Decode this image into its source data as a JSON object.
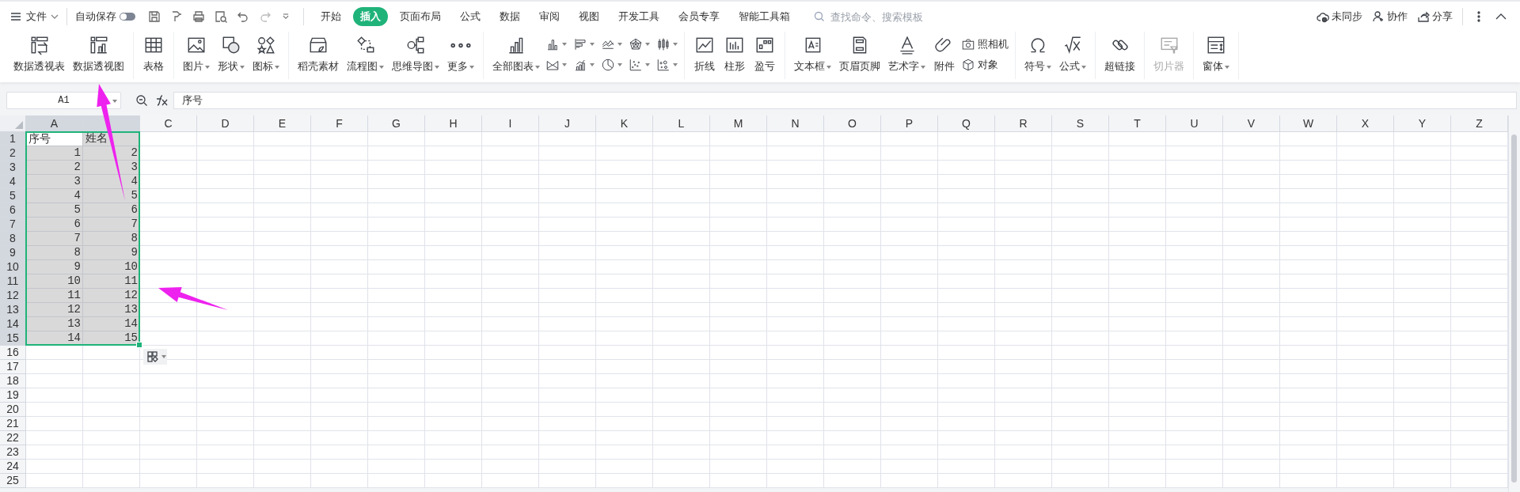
{
  "menu": {
    "label": "文件"
  },
  "autosave": {
    "label": "自动保存",
    "on": false
  },
  "tabs": [
    {
      "label": "开始",
      "selected": false
    },
    {
      "label": "插入",
      "selected": true
    },
    {
      "label": "页面布局",
      "selected": false
    },
    {
      "label": "公式",
      "selected": false
    },
    {
      "label": "数据",
      "selected": false
    },
    {
      "label": "审阅",
      "selected": false
    },
    {
      "label": "视图",
      "selected": false
    },
    {
      "label": "开发工具",
      "selected": false
    },
    {
      "label": "会员专享",
      "selected": false
    },
    {
      "label": "智能工具箱",
      "selected": false
    }
  ],
  "search": {
    "placeholder": "查找命令、搜索模板"
  },
  "actions": [
    {
      "label": "未同步"
    },
    {
      "label": "协作"
    },
    {
      "label": "分享"
    }
  ],
  "ribbon": [
    {
      "items": [
        {
          "kind": "large",
          "label": "数据透视表",
          "dropdown": false,
          "disabled": false
        },
        {
          "kind": "large",
          "label": "数据透视图",
          "dropdown": false,
          "disabled": false
        }
      ]
    },
    {
      "items": [
        {
          "kind": "large",
          "label": "表格",
          "dropdown": false,
          "disabled": false
        }
      ]
    },
    {
      "items": [
        {
          "kind": "large",
          "label": "图片",
          "dropdown": true,
          "disabled": false
        },
        {
          "kind": "large",
          "label": "形状",
          "dropdown": true,
          "disabled": false
        },
        {
          "kind": "large",
          "label": "图标",
          "dropdown": true,
          "disabled": false
        }
      ]
    },
    {
      "items": [
        {
          "kind": "large",
          "label": "稻壳素材",
          "dropdown": false,
          "disabled": false
        },
        {
          "kind": "large",
          "label": "流程图",
          "dropdown": true,
          "disabled": false
        },
        {
          "kind": "large",
          "label": "思维导图",
          "dropdown": true,
          "disabled": false
        },
        {
          "kind": "large",
          "label": "更多",
          "dropdown": true,
          "disabled": false
        }
      ]
    },
    {
      "items": [
        {
          "kind": "large",
          "label": "全部图表",
          "dropdown": true,
          "disabled": false
        },
        {
          "kind": "mini",
          "dropdown": true,
          "disabled": false
        },
        {
          "kind": "mini",
          "dropdown": true,
          "disabled": false
        },
        {
          "kind": "mini",
          "dropdown": true,
          "disabled": false
        },
        {
          "kind": "mini",
          "dropdown": true,
          "disabled": false
        },
        {
          "kind": "mini",
          "dropdown": true,
          "disabled": false
        },
        {
          "kind": "mini",
          "dropdown": true,
          "disabled": false
        },
        {
          "kind": "mini",
          "dropdown": true,
          "disabled": false
        },
        {
          "kind": "mini",
          "dropdown": true,
          "disabled": false
        },
        {
          "kind": "mini",
          "dropdown": true,
          "disabled": false
        },
        {
          "kind": "mini",
          "dropdown": true,
          "disabled": false
        }
      ]
    },
    {
      "items": [
        {
          "kind": "large",
          "label": "折线",
          "dropdown": false,
          "disabled": false
        },
        {
          "kind": "large",
          "label": "柱形",
          "dropdown": false,
          "disabled": false
        },
        {
          "kind": "large",
          "label": "盈亏",
          "dropdown": false,
          "disabled": false
        }
      ]
    },
    {
      "items": [
        {
          "kind": "large",
          "label": "文本框",
          "dropdown": true,
          "disabled": false
        },
        {
          "kind": "large",
          "label": "页眉页脚",
          "dropdown": false,
          "disabled": false
        },
        {
          "kind": "large",
          "label": "艺术字",
          "dropdown": true,
          "disabled": false
        },
        {
          "kind": "large",
          "label": "附件",
          "dropdown": false,
          "disabled": false
        },
        {
          "kind": "small",
          "label": "照相机",
          "dropdown": false,
          "disabled": false
        },
        {
          "kind": "small",
          "label": "对象",
          "dropdown": false,
          "disabled": false
        }
      ]
    },
    {
      "items": [
        {
          "kind": "large",
          "label": "符号",
          "dropdown": true,
          "disabled": false
        },
        {
          "kind": "large",
          "label": "公式",
          "dropdown": true,
          "disabled": false
        }
      ]
    },
    {
      "items": [
        {
          "kind": "large",
          "label": "超链接",
          "dropdown": false,
          "disabled": false
        }
      ]
    },
    {
      "items": [
        {
          "kind": "large",
          "label": "切片器",
          "dropdown": false,
          "disabled": true
        }
      ]
    },
    {
      "items": [
        {
          "kind": "large",
          "label": "窗体",
          "dropdown": true,
          "disabled": false
        }
      ]
    }
  ],
  "name_box": {
    "value": "A1"
  },
  "formula_bar": {
    "value": "序号"
  },
  "sheet": {
    "columns": [
      {
        "label": "A",
        "selected": true
      },
      {
        "selected": true
      },
      {
        "label": "C",
        "selected": false
      },
      {
        "label": "D",
        "selected": false
      },
      {
        "label": "E",
        "selected": false
      },
      {
        "label": "F",
        "selected": false
      },
      {
        "label": "G",
        "selected": false
      },
      {
        "label": "H",
        "selected": false
      },
      {
        "label": "I",
        "selected": false
      },
      {
        "label": "J",
        "selected": false
      },
      {
        "label": "K",
        "selected": false
      },
      {
        "label": "L",
        "selected": false
      },
      {
        "label": "M",
        "selected": false
      },
      {
        "label": "N",
        "selected": false
      },
      {
        "label": "O",
        "selected": false
      },
      {
        "label": "P",
        "selected": false
      },
      {
        "label": "Q",
        "selected": false
      },
      {
        "label": "R",
        "selected": false
      },
      {
        "label": "S",
        "selected": false
      },
      {
        "label": "T",
        "selected": false
      },
      {
        "label": "U",
        "selected": false
      },
      {
        "label": "V",
        "selected": false
      },
      {
        "label": "W",
        "selected": false
      },
      {
        "label": "X",
        "selected": false
      },
      {
        "label": "Y",
        "selected": false
      },
      {
        "label": "Z",
        "selected": false
      }
    ],
    "rows": [
      {
        "label": "1",
        "selected": true,
        "cells": [
          {
            "text": "序号",
            "kind": "text",
            "active": true
          },
          {
            "text": "姓名",
            "kind": "text",
            "active": false
          }
        ]
      },
      {
        "label": "2",
        "selected": true,
        "cells": [
          {
            "text": "1",
            "kind": "number",
            "active": false
          },
          {
            "text": "2",
            "kind": "number",
            "active": false
          }
        ]
      },
      {
        "label": "3",
        "selected": true,
        "cells": [
          {
            "text": "2",
            "kind": "number",
            "active": false
          },
          {
            "text": "3",
            "kind": "number",
            "active": false
          }
        ]
      },
      {
        "label": "4",
        "selected": true,
        "cells": [
          {
            "text": "3",
            "kind": "number",
            "active": false
          },
          {
            "text": "4",
            "kind": "number",
            "active": false
          }
        ]
      },
      {
        "label": "5",
        "selected": true,
        "cells": [
          {
            "text": "4",
            "kind": "number",
            "active": false
          },
          {
            "text": "5",
            "kind": "number",
            "active": false
          }
        ]
      },
      {
        "label": "6",
        "selected": true,
        "cells": [
          {
            "text": "5",
            "kind": "number",
            "active": false
          },
          {
            "text": "6",
            "kind": "number",
            "active": false
          }
        ]
      },
      {
        "label": "7",
        "selected": true,
        "cells": [
          {
            "text": "6",
            "kind": "number",
            "active": false
          },
          {
            "text": "7",
            "kind": "number",
            "active": false
          }
        ]
      },
      {
        "label": "8",
        "selected": true,
        "cells": [
          {
            "text": "7",
            "kind": "number",
            "active": false
          },
          {
            "text": "8",
            "kind": "number",
            "active": false
          }
        ]
      },
      {
        "label": "9",
        "selected": true,
        "cells": [
          {
            "text": "8",
            "kind": "number",
            "active": false
          },
          {
            "text": "9",
            "kind": "number",
            "active": false
          }
        ]
      },
      {
        "label": "10",
        "selected": true,
        "cells": [
          {
            "text": "9",
            "kind": "number",
            "active": false
          },
          {
            "text": "10",
            "kind": "number",
            "active": false
          }
        ]
      },
      {
        "label": "11",
        "selected": true,
        "cells": [
          {
            "text": "10",
            "kind": "number",
            "active": false
          },
          {
            "text": "11",
            "kind": "number",
            "active": false
          }
        ]
      },
      {
        "label": "12",
        "selected": true,
        "cells": [
          {
            "text": "11",
            "kind": "number",
            "active": false
          },
          {
            "text": "12",
            "kind": "number",
            "active": false
          }
        ]
      },
      {
        "label": "13",
        "selected": true,
        "cells": [
          {
            "text": "12",
            "kind": "number",
            "active": false
          },
          {
            "text": "13",
            "kind": "number",
            "active": false
          }
        ]
      },
      {
        "label": "14",
        "selected": true,
        "cells": [
          {
            "text": "13",
            "kind": "number",
            "active": false
          },
          {
            "text": "14",
            "kind": "number",
            "active": false
          }
        ]
      },
      {
        "label": "15",
        "selected": true,
        "cells": [
          {
            "text": "14",
            "kind": "number",
            "active": false
          },
          {
            "text": "15",
            "kind": "number",
            "active": false
          }
        ]
      },
      {
        "label": "16",
        "selected": false,
        "cells": []
      },
      {
        "label": "17",
        "selected": false,
        "cells": []
      },
      {
        "label": "18",
        "selected": false,
        "cells": []
      },
      {
        "label": "19",
        "selected": false,
        "cells": []
      },
      {
        "label": "20",
        "selected": false,
        "cells": []
      },
      {
        "label": "21",
        "selected": false,
        "cells": []
      },
      {
        "label": "22",
        "selected": false,
        "cells": []
      },
      {
        "label": "23",
        "selected": false,
        "cells": []
      },
      {
        "label": "24",
        "selected": false,
        "cells": []
      },
      {
        "label": "25",
        "selected": false,
        "cells": []
      }
    ]
  }
}
